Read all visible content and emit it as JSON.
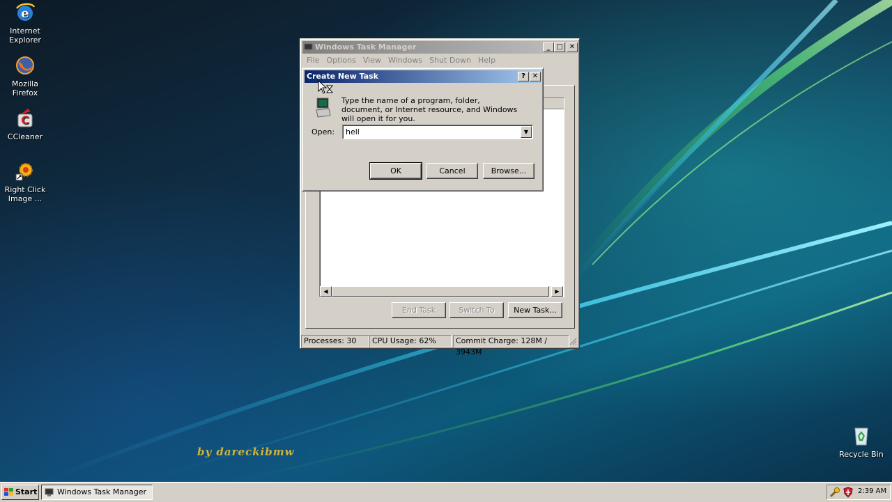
{
  "desktop": {
    "icons": [
      {
        "label": "Internet Explorer",
        "icon": "internet-explorer-icon"
      },
      {
        "label": "Mozilla Firefox",
        "icon": "firefox-icon"
      },
      {
        "label": "CCleaner",
        "icon": "ccleaner-icon"
      },
      {
        "label": "Right Click Image ...",
        "icon": "gear-icon"
      },
      {
        "label": "Recycle Bin",
        "icon": "recycle-bin-icon"
      }
    ],
    "watermark": "by dareckibmw"
  },
  "task_manager": {
    "title": "Windows Task Manager",
    "menu": [
      "File",
      "Options",
      "View",
      "Windows",
      "Shut Down",
      "Help"
    ],
    "buttons": {
      "end_task": "End Task",
      "switch_to": "Switch To",
      "new_task": "New Task..."
    },
    "status": {
      "processes": "Processes: 30",
      "cpu": "CPU Usage: 62%",
      "commit": "Commit Charge: 128M / 3943M"
    }
  },
  "dialog": {
    "title": "Create New Task",
    "help_button": "?",
    "description": "Type the name of a program, folder, document, or Internet resource, and Windows will open it for you.",
    "open_label": "Open:",
    "open_value": "hell",
    "ok": "OK",
    "cancel": "Cancel",
    "browse": "Browse..."
  },
  "taskbar": {
    "start_label": "Start",
    "tasks": [
      {
        "label": "Windows Task Manager",
        "active": true
      }
    ],
    "clock": "2:39 AM"
  },
  "colors": {
    "active_title_start": "#0a246a",
    "active_title_end": "#a6caf0",
    "window_face": "#d4d0c8",
    "watermark": "#d3b43a"
  }
}
